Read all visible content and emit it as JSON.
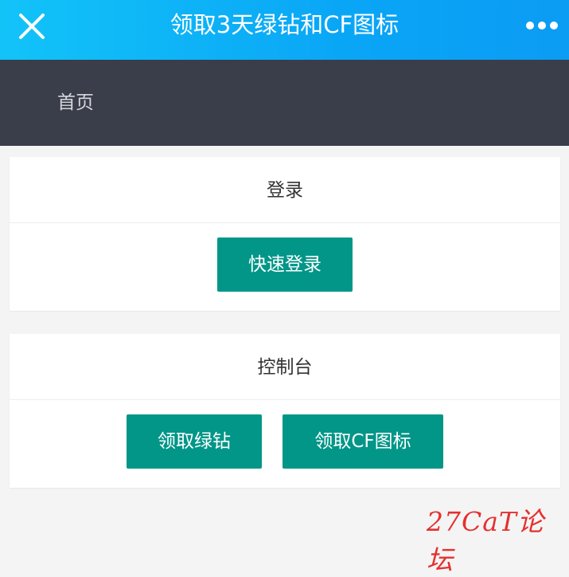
{
  "header": {
    "title": "领取3天绿钻和CF图标",
    "close_icon": "close-icon",
    "more_icon": "more-dots-icon"
  },
  "nav": {
    "home": "首页"
  },
  "login_card": {
    "title": "登录",
    "quick_login": "快速登录"
  },
  "console_card": {
    "title": "控制台",
    "green_diamond": "领取绿钻",
    "cf_icon": "领取CF图标"
  },
  "watermark": "27CaT论坛",
  "colors": {
    "header": "#0aa6f6",
    "nav": "#3a3d4a",
    "button": "#019688",
    "watermark": "#e53030"
  }
}
